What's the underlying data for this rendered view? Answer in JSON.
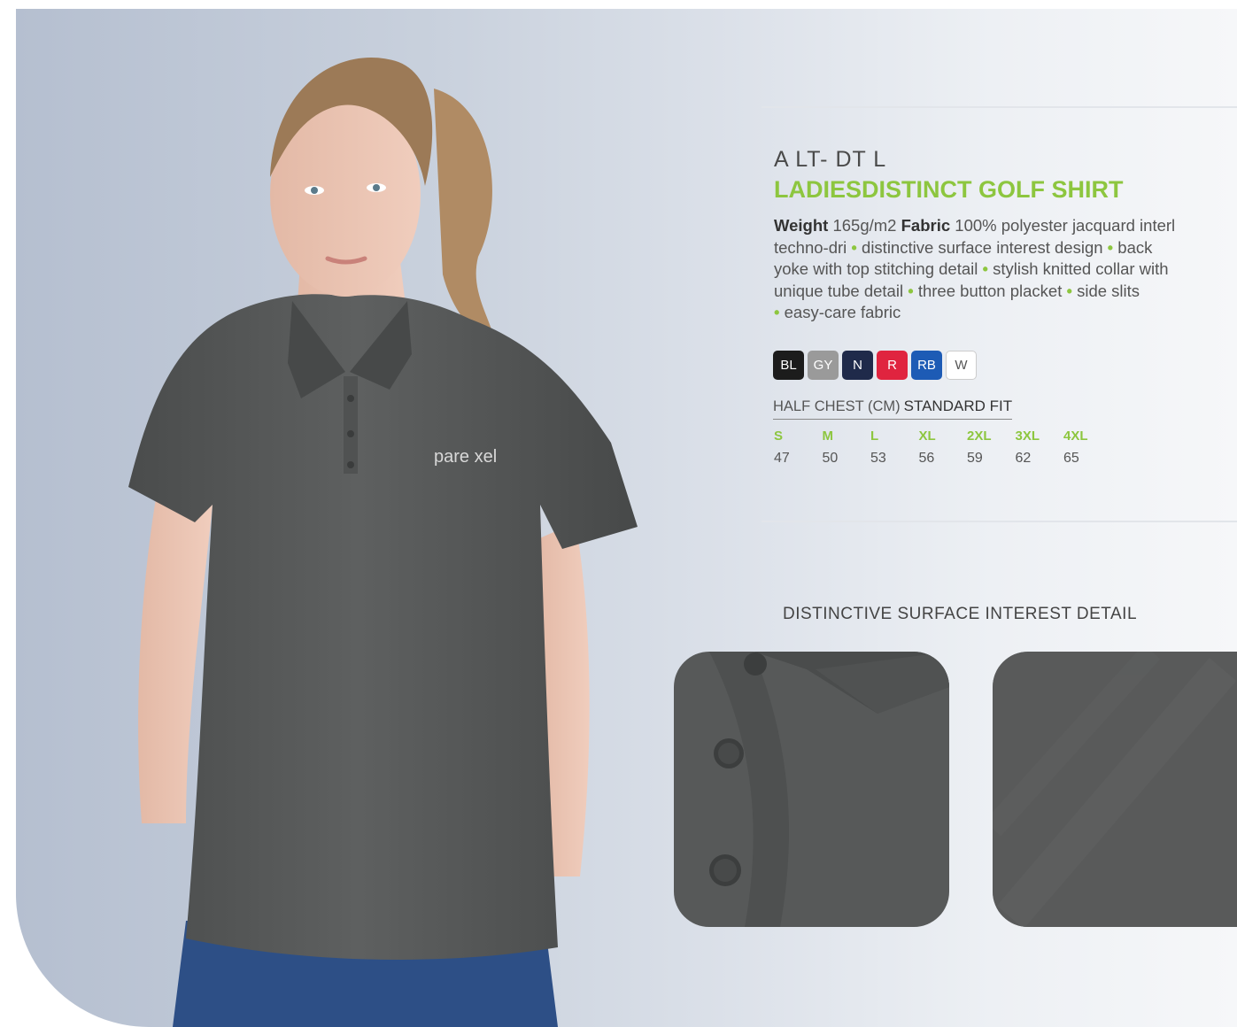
{
  "product": {
    "sku": "A LT- DT L",
    "title": "LADIESDISTINCT GOLF SHIRT",
    "logo_text": "pare xel",
    "weight_label": "Weight",
    "weight_value": "165g/m2",
    "fabric_label": "Fabric",
    "fabric_value": "100% polyester jacquard interl",
    "features_line1_a": "techno-dri",
    "features_line1_b": "distinctive surface interest design",
    "features_line1_c": "back",
    "features_line2_a": "yoke with top stitching detail",
    "features_line2_b": "stylish knitted collar with",
    "features_line3_a": "unique tube detail",
    "features_line3_b": "three button placket",
    "features_line3_c": "side slits",
    "features_line4_a": "easy-care fabric"
  },
  "colours": [
    {
      "code": "BL",
      "color": "#1c1c1c",
      "text": "#ffffff"
    },
    {
      "code": "GY",
      "color": "#9a9a9a",
      "text": "#ffffff"
    },
    {
      "code": "N",
      "color": "#1f2a4a",
      "text": "#ffffff"
    },
    {
      "code": "R",
      "color": "#e0243f",
      "text": "#ffffff"
    },
    {
      "code": "RB",
      "color": "#1d5bb5",
      "text": "#ffffff"
    },
    {
      "code": "W",
      "color": "#ffffff",
      "text": "#555555"
    }
  ],
  "size_chart": {
    "label": "HALF CHEST (CM)",
    "fit": "STANDARD FIT",
    "sizes": [
      "S",
      "M",
      "L",
      "XL",
      "2XL",
      "3XL",
      "4XL"
    ],
    "values": [
      "47",
      "50",
      "53",
      "56",
      "59",
      "62",
      "65"
    ]
  },
  "detail": {
    "title": "DISTINCTIVE SURFACE INTEREST DETAIL"
  },
  "theme": {
    "accent": "#8dc63f",
    "shirt": "#5a5c5c"
  }
}
